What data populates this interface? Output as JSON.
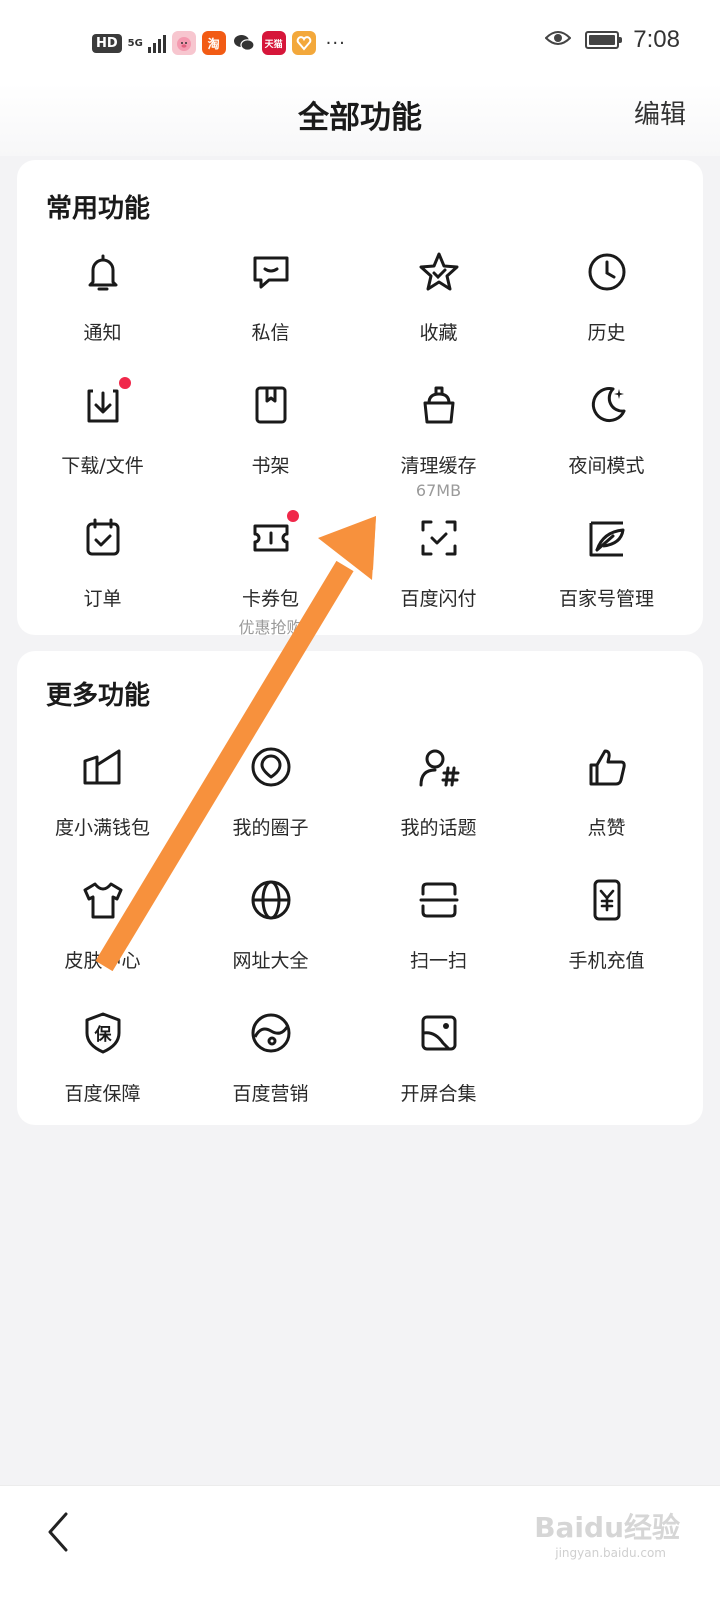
{
  "status_bar": {
    "hd": "HD",
    "network": "5G",
    "app_icons": [
      "piggy-app-icon",
      "taobao-app-icon",
      "wechat-app-icon",
      "tmall-app-icon",
      "heart-app-icon"
    ],
    "taobao_char": "淘",
    "tmall_char": "天猫",
    "more": "···",
    "time": "7:08"
  },
  "header": {
    "title": "全部功能",
    "edit": "编辑"
  },
  "common": {
    "title": "常用功能",
    "items": [
      {
        "label": "通知",
        "icon": "bell-icon"
      },
      {
        "label": "私信",
        "icon": "message-icon"
      },
      {
        "label": "收藏",
        "icon": "star-icon"
      },
      {
        "label": "历史",
        "icon": "clock-icon"
      },
      {
        "label": "下载/文件",
        "icon": "download-icon",
        "badge": true
      },
      {
        "label": "书架",
        "icon": "book-icon"
      },
      {
        "label": "清理缓存",
        "icon": "trash-icon",
        "sub": "67MB"
      },
      {
        "label": "夜间模式",
        "icon": "moon-icon"
      },
      {
        "label": "订单",
        "icon": "order-icon"
      },
      {
        "label": "卡券包",
        "icon": "ticket-icon",
        "sub": "优惠抢购",
        "badge": true
      },
      {
        "label": "百度闪付",
        "icon": "scan-pay-icon"
      },
      {
        "label": "百家号管理",
        "icon": "feather-icon"
      }
    ]
  },
  "more": {
    "title": "更多功能",
    "items": [
      {
        "label": "度小满钱包",
        "icon": "wallet-icon"
      },
      {
        "label": "我的圈子",
        "icon": "circle-icon"
      },
      {
        "label": "我的话题",
        "icon": "topic-icon"
      },
      {
        "label": "点赞",
        "icon": "thumbs-up-icon"
      },
      {
        "label": "皮肤中心",
        "icon": "shirt-icon"
      },
      {
        "label": "网址大全",
        "icon": "globe-icon"
      },
      {
        "label": "扫一扫",
        "icon": "scan-icon"
      },
      {
        "label": "手机充值",
        "icon": "phone-yen-icon"
      },
      {
        "label": "百度保障",
        "icon": "shield-icon"
      },
      {
        "label": "百度营销",
        "icon": "marketing-icon"
      },
      {
        "label": "开屏合集",
        "icon": "gallery-icon"
      }
    ]
  },
  "bottom": {
    "watermark": "Baidu经验",
    "watermark_url": "jingyan.baidu.com"
  },
  "colors": {
    "badge": "#f0284a",
    "arrow": "#f7913d"
  }
}
